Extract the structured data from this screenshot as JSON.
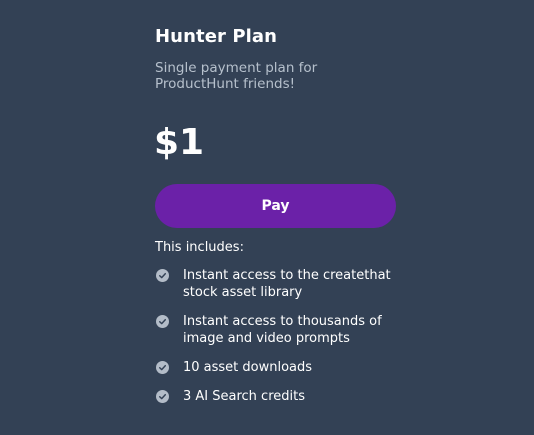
{
  "plan": {
    "title": "Hunter Plan",
    "description": "Single payment plan for ProductHunt friends!",
    "price": "$1",
    "pay_label": "Pay",
    "includes_label": "This includes:",
    "features": [
      {
        "text": "Instant access to the createthat stock asset library",
        "icon": "check-circle-icon"
      },
      {
        "text": "Instant access to thousands of image and video prompts",
        "icon": "check-circle-icon"
      },
      {
        "text": "10 asset downloads",
        "icon": "check-circle-icon"
      },
      {
        "text": "3 AI Search credits",
        "icon": "check-circle-icon"
      }
    ]
  },
  "colors": {
    "background": "#334155",
    "accent": "#6b21a8",
    "muted_text": "#b6c0cc",
    "check_icon": "#b3bcc8"
  }
}
